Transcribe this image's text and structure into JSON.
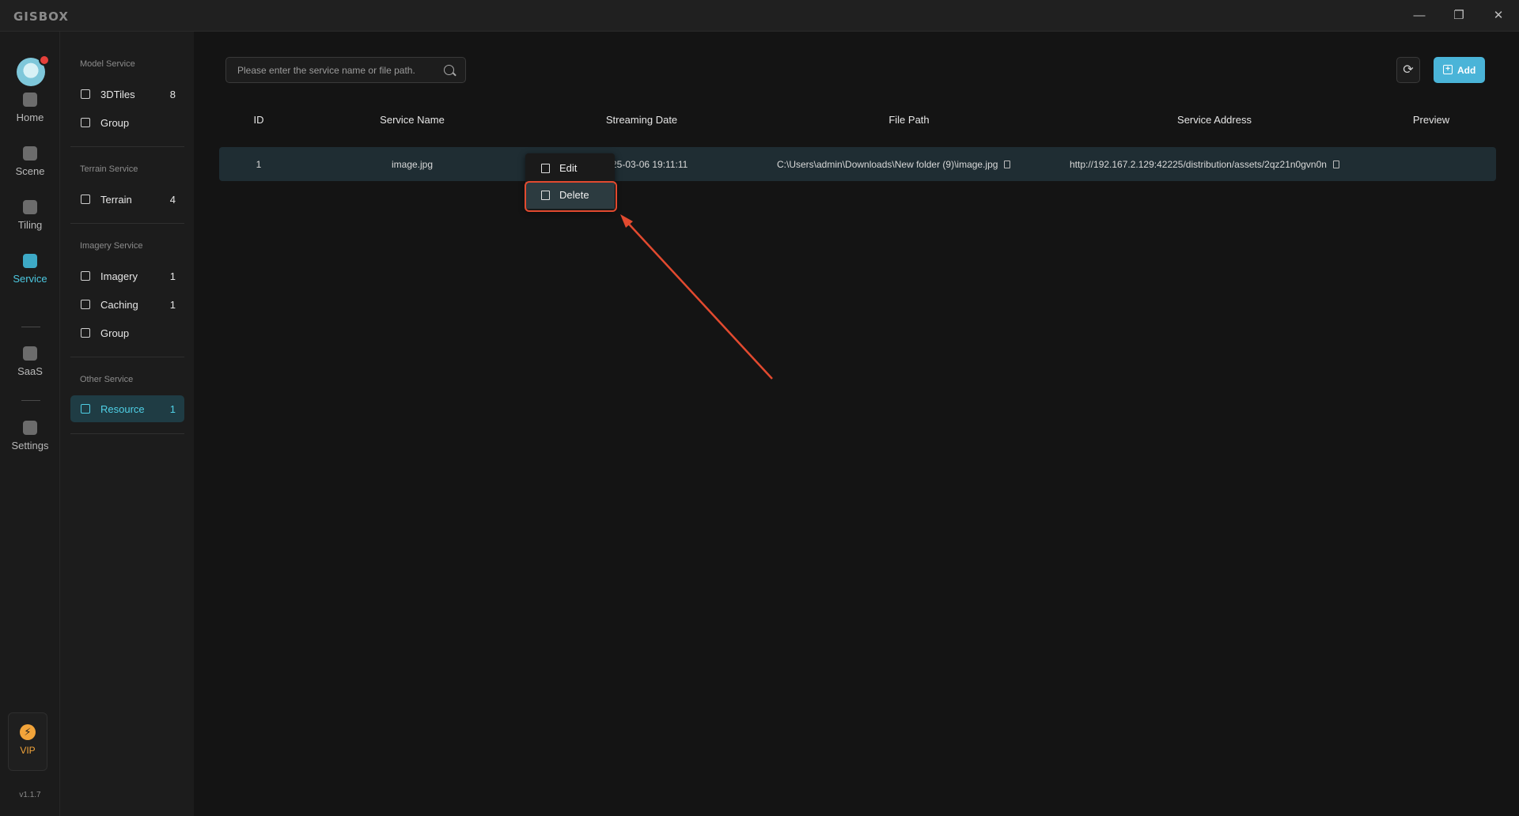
{
  "app": {
    "logo": "GISBOX"
  },
  "window_controls": {
    "minimize": "—",
    "maximize": "❐",
    "close": "✕"
  },
  "rail": {
    "items": [
      {
        "label": "Home",
        "icon": "home-icon"
      },
      {
        "label": "Scene",
        "icon": "scene-icon"
      },
      {
        "label": "Tiling",
        "icon": "tiling-icon"
      },
      {
        "label": "Service",
        "icon": "service-icon",
        "active": true
      },
      {
        "label": "SaaS",
        "icon": "saas-icon"
      },
      {
        "label": "Settings",
        "icon": "settings-icon"
      }
    ],
    "vip": "VIP",
    "vip_icon": "⚡",
    "version": "v1.1.7"
  },
  "sidebar": {
    "model_section": "Model Service",
    "model_items": [
      {
        "label": "3DTiles",
        "count": "8"
      },
      {
        "label": "Group",
        "count": ""
      }
    ],
    "terrain_section": "Terrain Service",
    "terrain_items": [
      {
        "label": "Terrain",
        "count": "4"
      }
    ],
    "imagery_section": "Imagery Service",
    "imagery_items": [
      {
        "label": "Imagery",
        "count": "1"
      },
      {
        "label": "Caching",
        "count": "1"
      },
      {
        "label": "Group",
        "count": ""
      }
    ],
    "other_section": "Other Service",
    "other_items": [
      {
        "label": "Resource",
        "count": "1",
        "active": true
      }
    ]
  },
  "toolbar": {
    "search_placeholder": "Please enter the service name or file path.",
    "refresh_icon": "⟳",
    "add_label": "Add",
    "add_icon": "+"
  },
  "table": {
    "headers": [
      "ID",
      "Service Name",
      "Streaming Date",
      "File Path",
      "Service Address",
      "Preview"
    ],
    "rows": [
      {
        "id": "1",
        "name": "image.jpg",
        "date": "25-03-06 19:11:11",
        "path": "C:\\Users\\admin\\Downloads\\New folder (9)\\image.jpg",
        "address": "http://192.167.2.129:42225/distribution/assets/2qz21n0gvn0n"
      }
    ]
  },
  "context_menu": {
    "edit": "Edit",
    "delete": "Delete"
  },
  "colors": {
    "accent": "#4ab4d8",
    "annotation": "#e24a2f",
    "active_bg": "#1f3c44"
  }
}
